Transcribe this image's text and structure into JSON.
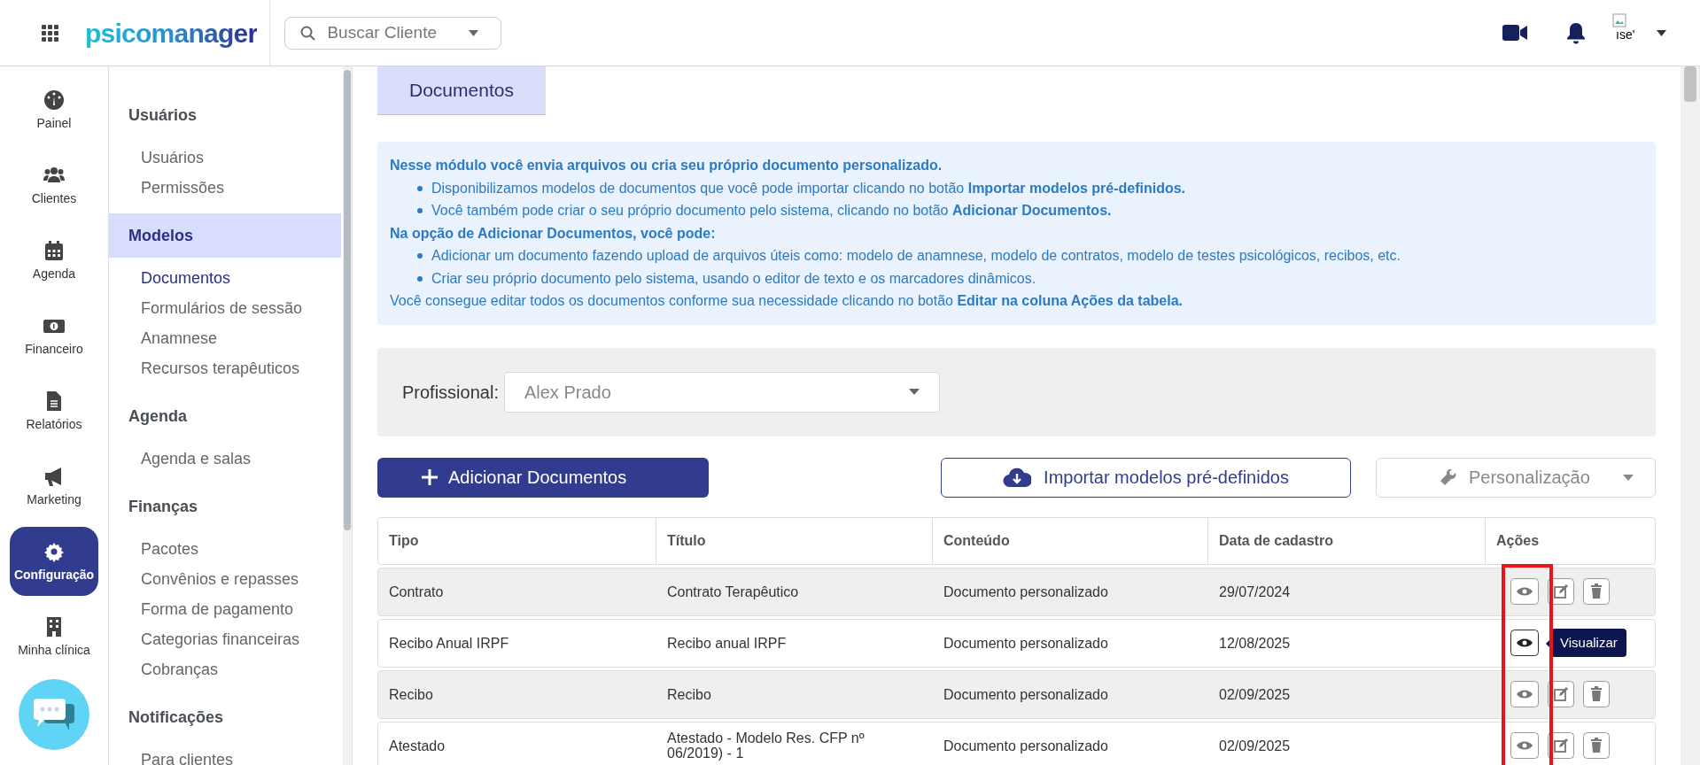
{
  "top_bar": {
    "logo": "psicomanager",
    "search": {
      "placeholder": "Buscar Cliente"
    },
    "avatar_alt": "ıse'"
  },
  "nav_rail": [
    {
      "label": "Painel",
      "selected": false
    },
    {
      "label": "Clientes",
      "selected": false
    },
    {
      "label": "Agenda",
      "selected": false
    },
    {
      "label": "Financeiro",
      "selected": false
    },
    {
      "label": "Relatórios",
      "selected": false
    },
    {
      "label": "Marketing",
      "selected": false
    },
    {
      "label": "Configuração",
      "selected": true
    },
    {
      "label": "Minha clínica",
      "selected": false
    }
  ],
  "submenu": [
    {
      "title": "Usuários",
      "selected": false,
      "items": [
        {
          "label": "Usuários",
          "selected": false
        },
        {
          "label": "Permissões",
          "selected": false
        }
      ]
    },
    {
      "title": "Modelos",
      "selected": true,
      "items": [
        {
          "label": "Documentos",
          "selected": true
        },
        {
          "label": "Formulários de sessão",
          "selected": false
        },
        {
          "label": "Anamnese",
          "selected": false
        },
        {
          "label": "Recursos terapêuticos",
          "selected": false
        }
      ]
    },
    {
      "title": "Agenda",
      "selected": false,
      "items": [
        {
          "label": "Agenda e salas",
          "selected": false
        }
      ]
    },
    {
      "title": "Finanças",
      "selected": false,
      "items": [
        {
          "label": "Pacotes",
          "selected": false
        },
        {
          "label": "Convênios e repasses",
          "selected": false
        },
        {
          "label": "Forma de pagamento",
          "selected": false
        },
        {
          "label": "Categorias financeiras",
          "selected": false
        },
        {
          "label": "Cobranças",
          "selected": false
        }
      ]
    },
    {
      "title": "Notificações",
      "selected": false,
      "items": [
        {
          "label": "Para clientes",
          "selected": false
        }
      ]
    }
  ],
  "page_tab": {
    "label": "Documentos",
    "selected": true
  },
  "info": [
    {
      "kind": "heading",
      "text": "Nesse módulo você envia arquivos ou cria seu próprio documento personalizado."
    },
    {
      "kind": "bullet",
      "text": "Disponibilizamos modelos de documentos que você pode importar clicando no botão **Importar modelos pré-definidos.**"
    },
    {
      "kind": "bullet",
      "text": "Você também pode criar o seu próprio documento pelo sistema, clicando no botão **Adicionar Documentos.**"
    },
    {
      "kind": "heading",
      "text": "Na opção de Adicionar Documentos, você pode:"
    },
    {
      "kind": "bullet",
      "text": "Adicionar um documento fazendo upload de arquivos úteis como: modelo de anamnese, modelo de contratos, modelo de testes psicológicos, recibos, etc."
    },
    {
      "kind": "bullet",
      "text": "Criar seu próprio documento pelo sistema, usando o editor de texto e os marcadores dinâmicos."
    },
    {
      "kind": "para",
      "text": "Você consegue editar todos os documentos conforme sua necessidade clicando no botão **Editar na coluna Ações da tabela.**"
    }
  ],
  "filter": {
    "label": "Profissional:",
    "value": "Alex Prado"
  },
  "buttons": [
    {
      "kind": "primary",
      "label": "Adicionar Documentos"
    },
    {
      "kind": "outline",
      "label": "Importar modelos pré-definidos"
    },
    {
      "kind": "dropdown",
      "label": "Personalização"
    }
  ],
  "table": {
    "columns": [
      "Tipo",
      "Título",
      "Conteúdo",
      "Data de cadastro",
      "Ações"
    ],
    "actions_highlighted": true,
    "rows": [
      {
        "cells": [
          "Contrato",
          "Contrato Terapêutico",
          "Documento personalizado",
          "29/07/2024"
        ],
        "hovered": false
      },
      {
        "cells": [
          "Recibo Anual IRPF",
          "Recibo anual IRPF",
          "Documento personalizado",
          "12/08/2025"
        ],
        "hovered": true,
        "tooltip": "Visualizar"
      },
      {
        "cells": [
          "Recibo",
          "Recibo",
          "Documento personalizado",
          "02/09/2025"
        ],
        "hovered": false
      },
      {
        "cells": [
          "Atestado",
          "Atestado - Modelo Res. CFP nº 06/2019) - 1",
          "Documento personalizado",
          "02/09/2025"
        ],
        "hovered": false
      }
    ]
  }
}
